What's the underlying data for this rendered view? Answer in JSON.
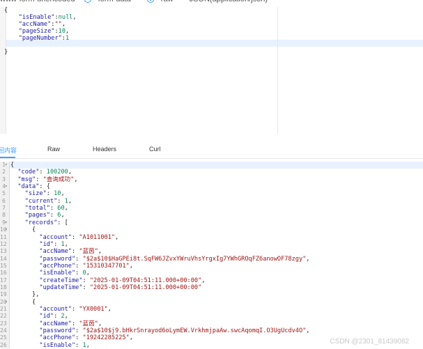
{
  "top_bar": {
    "urlencoded_label": "www-form-urlencoded",
    "formdata_label": "form-data",
    "raw_label": "raw",
    "content_type": "JSON(application/json)"
  },
  "request_body": [
    {
      "indent": "",
      "text": "{"
    },
    {
      "indent": "    ",
      "key": "\"isEnable\"",
      "sep": ":",
      "val": "null",
      "end": ","
    },
    {
      "indent": "    ",
      "key": "\"accName\"",
      "sep": ":",
      "val": "\"\"",
      "end": ","
    },
    {
      "indent": "    ",
      "key": "\"pageSize\"",
      "sep": ":",
      "val": "10",
      "end": ","
    },
    {
      "indent": "    ",
      "key": "\"pageNumber\"",
      "sep": ":",
      "val": "1",
      "end": ""
    },
    {
      "indent": "",
      "text": ""
    },
    {
      "indent": "",
      "text": "}"
    }
  ],
  "tabs": [
    {
      "label": "返回内容",
      "active": true
    },
    {
      "label": "Raw",
      "active": false
    },
    {
      "label": "Headers",
      "active": false
    },
    {
      "label": "Curl",
      "active": false
    }
  ],
  "response_lines": [
    {
      "n": "1",
      "fold": true,
      "indent": "",
      "text": "{"
    },
    {
      "n": "2",
      "indent": "  ",
      "key": "\"code\"",
      "val": "100200",
      "type": "n",
      "end": ","
    },
    {
      "n": "3",
      "indent": "  ",
      "key": "\"msg\"",
      "val": "\"查询成功\"",
      "type": "s",
      "end": ","
    },
    {
      "n": "4",
      "fold": true,
      "indent": "  ",
      "key": "\"data\"",
      "val": "{",
      "type": "p",
      "end": ""
    },
    {
      "n": "5",
      "indent": "    ",
      "key": "\"size\"",
      "val": "10",
      "type": "n",
      "end": ","
    },
    {
      "n": "6",
      "indent": "    ",
      "key": "\"current\"",
      "val": "1",
      "type": "n",
      "end": ","
    },
    {
      "n": "7",
      "indent": "    ",
      "key": "\"total\"",
      "val": "60",
      "type": "n",
      "end": ","
    },
    {
      "n": "8",
      "indent": "    ",
      "key": "\"pages\"",
      "val": "6",
      "type": "n",
      "end": ","
    },
    {
      "n": "9",
      "fold": true,
      "indent": "    ",
      "key": "\"records\"",
      "val": "[",
      "type": "p",
      "end": ""
    },
    {
      "n": "10",
      "fold": true,
      "indent": "      ",
      "text": "{"
    },
    {
      "n": "11",
      "indent": "        ",
      "key": "\"account\"",
      "val": "\"A1011001\"",
      "type": "s",
      "end": ","
    },
    {
      "n": "12",
      "indent": "        ",
      "key": "\"id\"",
      "val": "1",
      "type": "n",
      "end": ","
    },
    {
      "n": "13",
      "indent": "        ",
      "key": "\"accName\"",
      "val": "\"蓝茵\"",
      "type": "s",
      "end": ","
    },
    {
      "n": "14",
      "indent": "        ",
      "key": "\"password\"",
      "val": "\"$2a$10$HaGPEi8t.SqFW6JZvxYWruVhsYrgxIg7YWhGROqFZ6anowOF78zgy\"",
      "type": "s",
      "end": ","
    },
    {
      "n": "15",
      "indent": "        ",
      "key": "\"accPhone\"",
      "val": "\"15310347701\"",
      "type": "s",
      "end": ","
    },
    {
      "n": "16",
      "indent": "        ",
      "key": "\"isEnable\"",
      "val": "0",
      "type": "n",
      "end": ","
    },
    {
      "n": "17",
      "indent": "        ",
      "key": "\"createTime\"",
      "val": "\"2025-01-09T04:51:11.000+00:00\"",
      "type": "s",
      "end": ","
    },
    {
      "n": "18",
      "indent": "        ",
      "key": "\"updateTime\"",
      "val": "\"2025-01-09T04:51:11.000+00:00\"",
      "type": "s",
      "end": ""
    },
    {
      "n": "19",
      "indent": "      ",
      "text": "},"
    },
    {
      "n": "20",
      "fold": true,
      "indent": "      ",
      "text": "{"
    },
    {
      "n": "21",
      "indent": "        ",
      "key": "\"account\"",
      "val": "\"YX0001\"",
      "type": "s",
      "end": ","
    },
    {
      "n": "22",
      "indent": "        ",
      "key": "\"id\"",
      "val": "2",
      "type": "n",
      "end": ","
    },
    {
      "n": "23",
      "indent": "        ",
      "key": "\"accName\"",
      "val": "\"蓝茵\"",
      "type": "s",
      "end": ","
    },
    {
      "n": "24",
      "indent": "        ",
      "key": "\"password\"",
      "val": "\"$2a$10$j9.bHkrSnrayod6oLymEW.VrkhmjpaAw.swcAqomqI.O3UgUcdv4O\"",
      "type": "s",
      "end": ","
    },
    {
      "n": "25",
      "indent": "        ",
      "key": "\"accPhone\"",
      "val": "\"19242285225\"",
      "type": "s",
      "end": ","
    },
    {
      "n": "26",
      "indent": "        ",
      "key": "\"isEnable\"",
      "val": "1",
      "type": "n",
      "end": ","
    }
  ],
  "watermark": "CSDN @2301_81439082"
}
